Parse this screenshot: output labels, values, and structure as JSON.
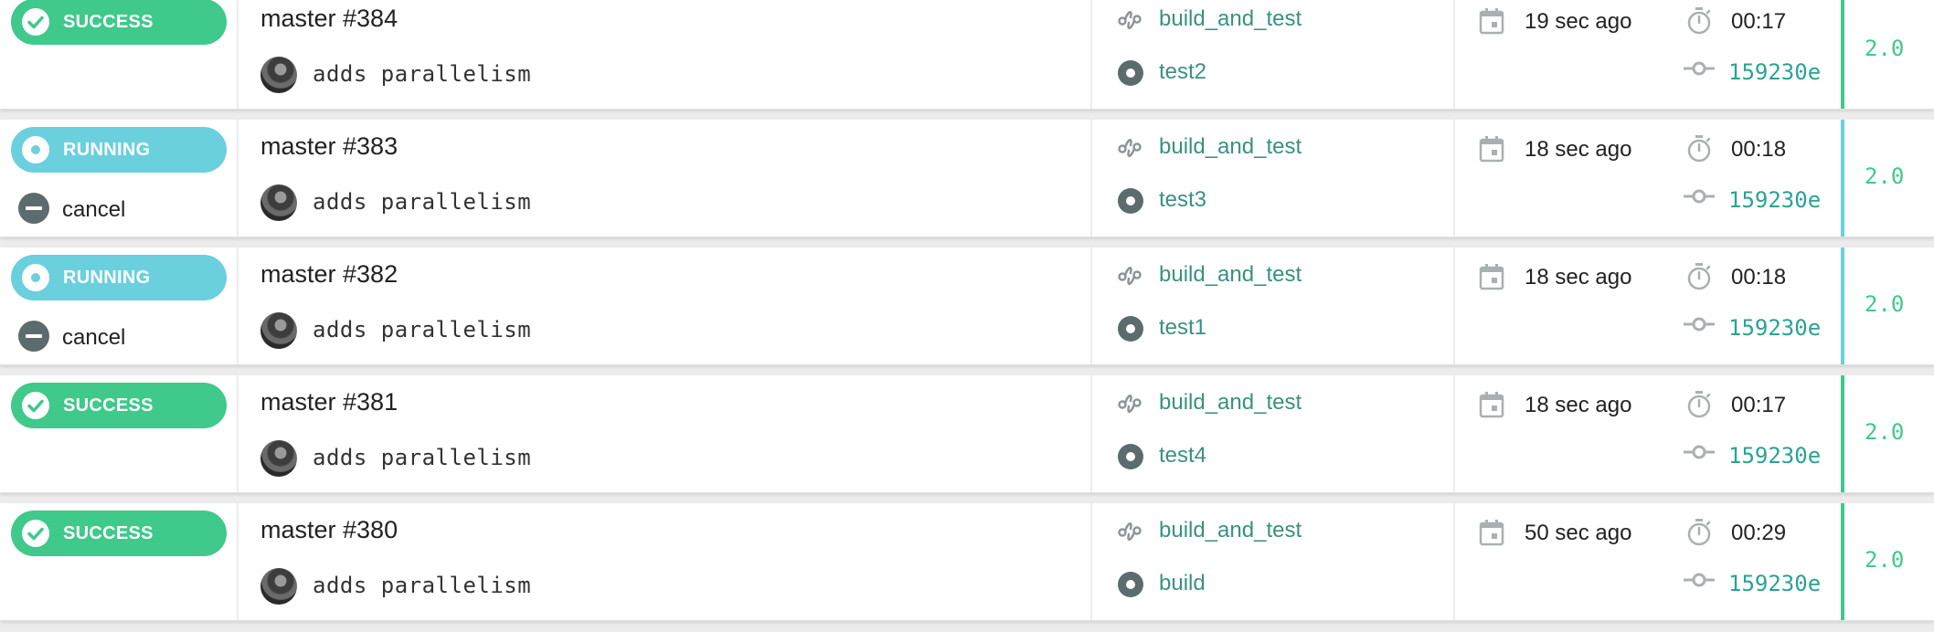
{
  "colors": {
    "success": "#3fc98a",
    "running": "#6ad0dd",
    "link": "#3a9082",
    "sha": "#2aa394",
    "icon_gray": "#5b6b6e"
  },
  "icons": {
    "success": "check-circle-icon",
    "running": "running-icon",
    "cancel": "cancel-icon",
    "pipeline": "pipeline-icon",
    "job": "job-icon",
    "calendar": "calendar-icon",
    "timer": "timer-icon",
    "commit": "commit-icon"
  },
  "builds": [
    {
      "status": "success",
      "status_label": "SUCCESS",
      "cancel_label": "",
      "title": "master #384",
      "message": "adds parallelism",
      "pipeline": "build_and_test",
      "job": "test2",
      "ago": "19 sec ago",
      "duration": "00:17",
      "sha": "159230e",
      "version": "2.0"
    },
    {
      "status": "running",
      "status_label": "RUNNING",
      "cancel_label": "cancel",
      "title": "master #383",
      "message": "adds parallelism",
      "pipeline": "build_and_test",
      "job": "test3",
      "ago": "18 sec ago",
      "duration": "00:18",
      "sha": "159230e",
      "version": "2.0"
    },
    {
      "status": "running",
      "status_label": "RUNNING",
      "cancel_label": "cancel",
      "title": "master #382",
      "message": "adds parallelism",
      "pipeline": "build_and_test",
      "job": "test1",
      "ago": "18 sec ago",
      "duration": "00:18",
      "sha": "159230e",
      "version": "2.0"
    },
    {
      "status": "success",
      "status_label": "SUCCESS",
      "cancel_label": "",
      "title": "master #381",
      "message": "adds parallelism",
      "pipeline": "build_and_test",
      "job": "test4",
      "ago": "18 sec ago",
      "duration": "00:17",
      "sha": "159230e",
      "version": "2.0"
    },
    {
      "status": "success",
      "status_label": "SUCCESS",
      "cancel_label": "",
      "title": "master #380",
      "message": "adds parallelism",
      "pipeline": "build_and_test",
      "job": "build",
      "ago": "50 sec ago",
      "duration": "00:29",
      "sha": "159230e",
      "version": "2.0"
    }
  ]
}
